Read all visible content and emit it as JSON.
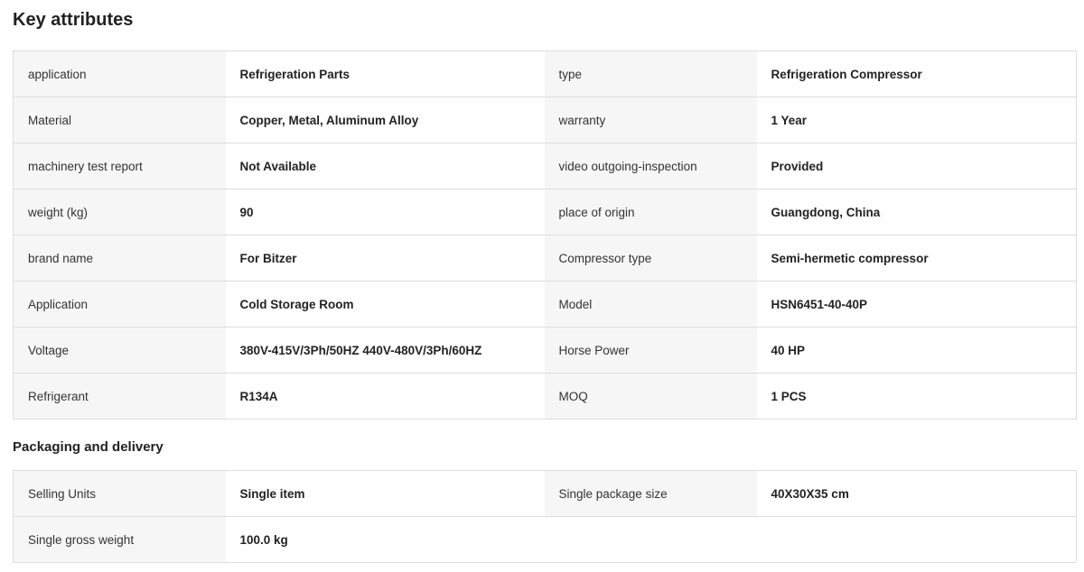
{
  "key_attributes": {
    "title": "Key attributes",
    "rows": [
      [
        {
          "k": "application",
          "v": "Refrigeration Parts"
        },
        {
          "k": "type",
          "v": "Refrigeration Compressor"
        }
      ],
      [
        {
          "k": "Material",
          "v": "Copper, Metal, Aluminum Alloy"
        },
        {
          "k": "warranty",
          "v": "1 Year"
        }
      ],
      [
        {
          "k": "machinery test report",
          "v": "Not Available"
        },
        {
          "k": "video outgoing-inspection",
          "v": "Provided"
        }
      ],
      [
        {
          "k": "weight (kg)",
          "v": "90"
        },
        {
          "k": "place of origin",
          "v": "Guangdong, China"
        }
      ],
      [
        {
          "k": "brand name",
          "v": "For Bitzer"
        },
        {
          "k": "Compressor type",
          "v": "Semi-hermetic compressor"
        }
      ],
      [
        {
          "k": "Application",
          "v": "Cold Storage Room"
        },
        {
          "k": "Model",
          "v": "HSN6451-40-40P"
        }
      ],
      [
        {
          "k": "Voltage",
          "v": "380V-415V/3Ph/50HZ 440V-480V/3Ph/60HZ"
        },
        {
          "k": "Horse Power",
          "v": "40 HP"
        }
      ],
      [
        {
          "k": "Refrigerant",
          "v": "R134A"
        },
        {
          "k": "MOQ",
          "v": "1 PCS"
        }
      ]
    ]
  },
  "packaging_delivery": {
    "title": "Packaging and delivery",
    "rows": [
      [
        {
          "k": "Selling Units",
          "v": "Single item"
        },
        {
          "k": "Single package size",
          "v": "40X30X35 cm"
        }
      ],
      [
        {
          "k": "Single gross weight",
          "v": "100.0 kg"
        }
      ]
    ]
  }
}
